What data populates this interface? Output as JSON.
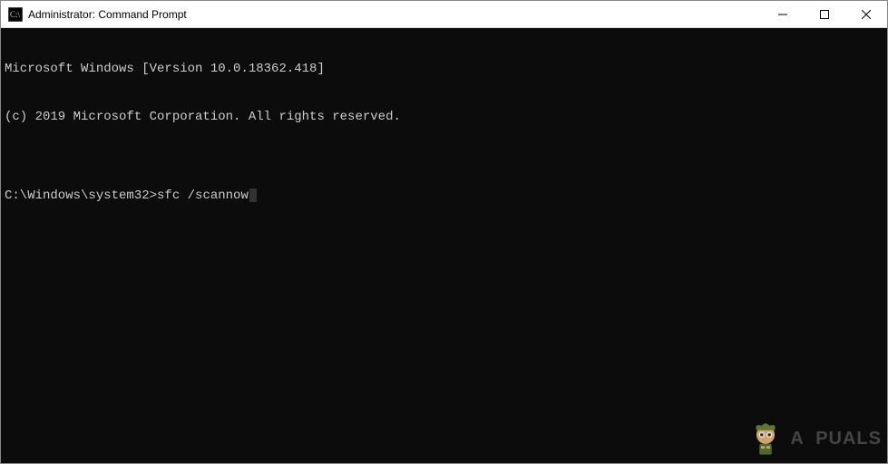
{
  "window": {
    "title": "Administrator: Command Prompt"
  },
  "terminal": {
    "line1": "Microsoft Windows [Version 10.0.18362.418]",
    "line2": "(c) 2019 Microsoft Corporation. All rights reserved.",
    "blank": "",
    "prompt": "C:\\Windows\\system32>",
    "command": "sfc /scannow"
  },
  "watermark": {
    "text": "A  PUALS"
  }
}
